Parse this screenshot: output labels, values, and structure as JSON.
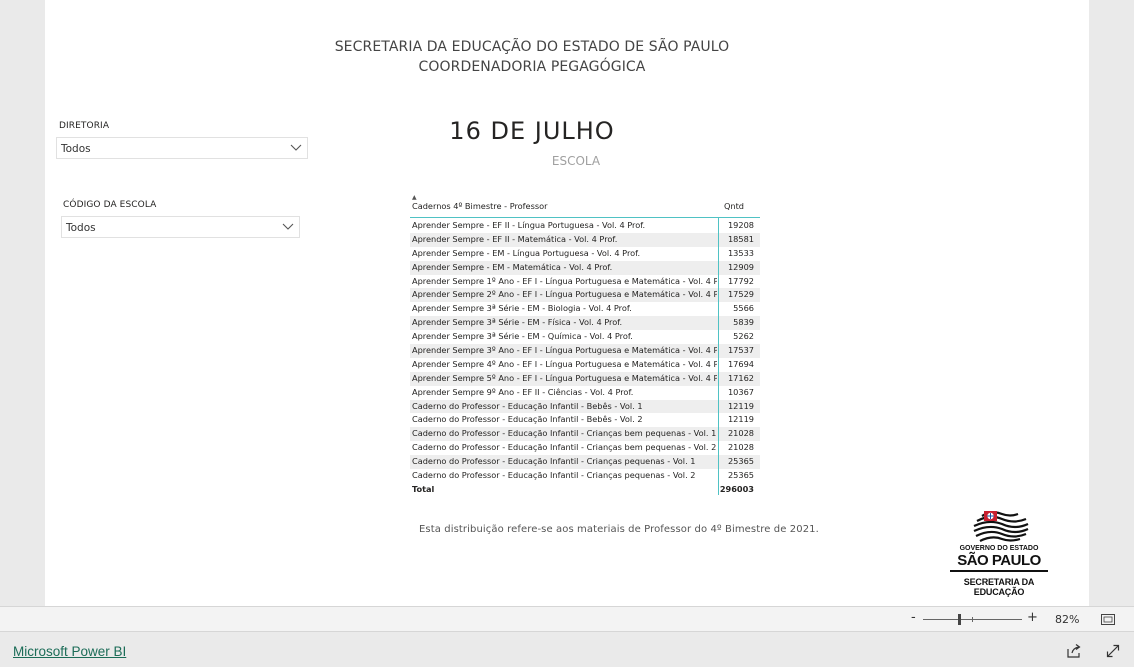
{
  "header": {
    "line1": "SECRETARIA DA EDUCAÇÃO DO ESTADO DE SÃO PAULO",
    "line2": "COORDENADORIA PEGAGÓGICA"
  },
  "date_title": "16 DE JULHO",
  "subtitle": "ESCOLA",
  "slicers": {
    "diretoria": {
      "label": "DIRETORIA",
      "value": "Todos"
    },
    "codigo": {
      "label": "CÓDIGO DA ESCOLA",
      "value": "Todos"
    }
  },
  "table": {
    "col1": "Cadernos 4º Bimestre - Professor",
    "col2": "Qntd",
    "rows": [
      {
        "name": "Aprender Sempre - EF II - Língua Portuguesa - Vol. 4 Prof.",
        "value": "19208"
      },
      {
        "name": "Aprender Sempre - EF II - Matemática - Vol. 4 Prof.",
        "value": "18581"
      },
      {
        "name": "Aprender Sempre - EM - Língua Portuguesa - Vol. 4 Prof.",
        "value": "13533"
      },
      {
        "name": "Aprender Sempre - EM - Matemática - Vol. 4 Prof.",
        "value": "12909"
      },
      {
        "name": "Aprender Sempre 1º Ano - EF I - Língua Portuguesa e Matemática - Vol. 4 Prof.",
        "value": "17792"
      },
      {
        "name": "Aprender Sempre 2º Ano - EF I - Língua Portuguesa e Matemática - Vol. 4 Prof.",
        "value": "17529"
      },
      {
        "name": "Aprender Sempre 3ª Série - EM - Biologia - Vol. 4 Prof.",
        "value": "5566"
      },
      {
        "name": "Aprender Sempre 3ª Série - EM - Física - Vol. 4 Prof.",
        "value": "5839"
      },
      {
        "name": "Aprender Sempre 3ª Série - EM - Química - Vol. 4 Prof.",
        "value": "5262"
      },
      {
        "name": "Aprender Sempre 3º Ano - EF I - Língua Portuguesa e Matemática - Vol. 4 Prof.",
        "value": "17537"
      },
      {
        "name": "Aprender Sempre 4º Ano - EF I - Língua Portuguesa e Matemática - Vol. 4 Prof.",
        "value": "17694"
      },
      {
        "name": "Aprender Sempre 5º Ano - EF I - Língua Portuguesa e Matemática - Vol. 4 Prof.",
        "value": "17162"
      },
      {
        "name": "Aprender Sempre 9º Ano - EF II - Ciências - Vol. 4 Prof.",
        "value": "10367"
      },
      {
        "name": "Caderno do Professor - Educação Infantil - Bebês - Vol. 1",
        "value": "12119"
      },
      {
        "name": "Caderno do Professor - Educação Infantil - Bebês - Vol. 2",
        "value": "12119"
      },
      {
        "name": "Caderno do Professor - Educação Infantil - Crianças bem pequenas - Vol. 1",
        "value": "21028"
      },
      {
        "name": "Caderno do Professor - Educação Infantil - Crianças bem pequenas - Vol. 2",
        "value": "21028"
      },
      {
        "name": "Caderno do Professor - Educação Infantil - Crianças pequenas - Vol. 1",
        "value": "25365"
      },
      {
        "name": "Caderno do Professor - Educação Infantil - Crianças pequenas - Vol. 2",
        "value": "25365"
      }
    ],
    "total_label": "Total",
    "total_value": "296003"
  },
  "footnote": "Esta distribuição refere-se aos materiais de Professor do 4º Bimestre de 2021.",
  "logo": {
    "line1": "GOVERNO DO ESTADO",
    "line2": "SÃO PAULO",
    "line3": "SECRETARIA DA EDUCAÇÃO"
  },
  "zoom": {
    "minus": "-",
    "plus": "+",
    "percent": "82%",
    "level": 0.36
  },
  "footer": {
    "brand": "Microsoft Power BI"
  },
  "icons": [
    "chevron-down-icon",
    "sort-up-icon",
    "fit-page-icon",
    "share-icon",
    "expand-icon"
  ]
}
